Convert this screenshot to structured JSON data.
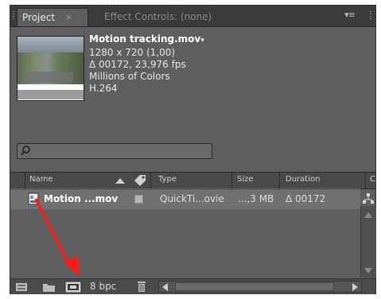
{
  "tabs": {
    "project": {
      "label": "Project",
      "close": "×"
    },
    "effects": {
      "label": "Effect Controls: (none)"
    },
    "menu_glyph": "▾≡"
  },
  "file_info": {
    "name": "Motion tracking.mov",
    "caret": "▾",
    "dimensions": "1280 x 720 (1,00)",
    "duration": "Δ 00172, 23,976 fps",
    "colors": "Millions of Colors",
    "codec": "H.264"
  },
  "search": {
    "placeholder": "",
    "value": ""
  },
  "columns": {
    "name": "Name",
    "type": "Type",
    "size": "Size",
    "duration": "Duration",
    "extra": "C"
  },
  "rows": [
    {
      "name": "Motion ...mov",
      "type": "QuickTi...ovie",
      "size": "...,3 MB",
      "duration": "Δ 00172"
    }
  ],
  "bottom": {
    "bpc": "8 bpc"
  },
  "colors": {
    "panel": "#5f5f5f",
    "tabbar": "#3b3b3b",
    "row": "#707070",
    "annotation_arrow": "#ff1a1a"
  },
  "icons": [
    "interpret-footage-icon",
    "folder-icon",
    "composition-icon",
    "trash-icon",
    "flowchart-icon",
    "search-icon",
    "movie-file-icon"
  ]
}
